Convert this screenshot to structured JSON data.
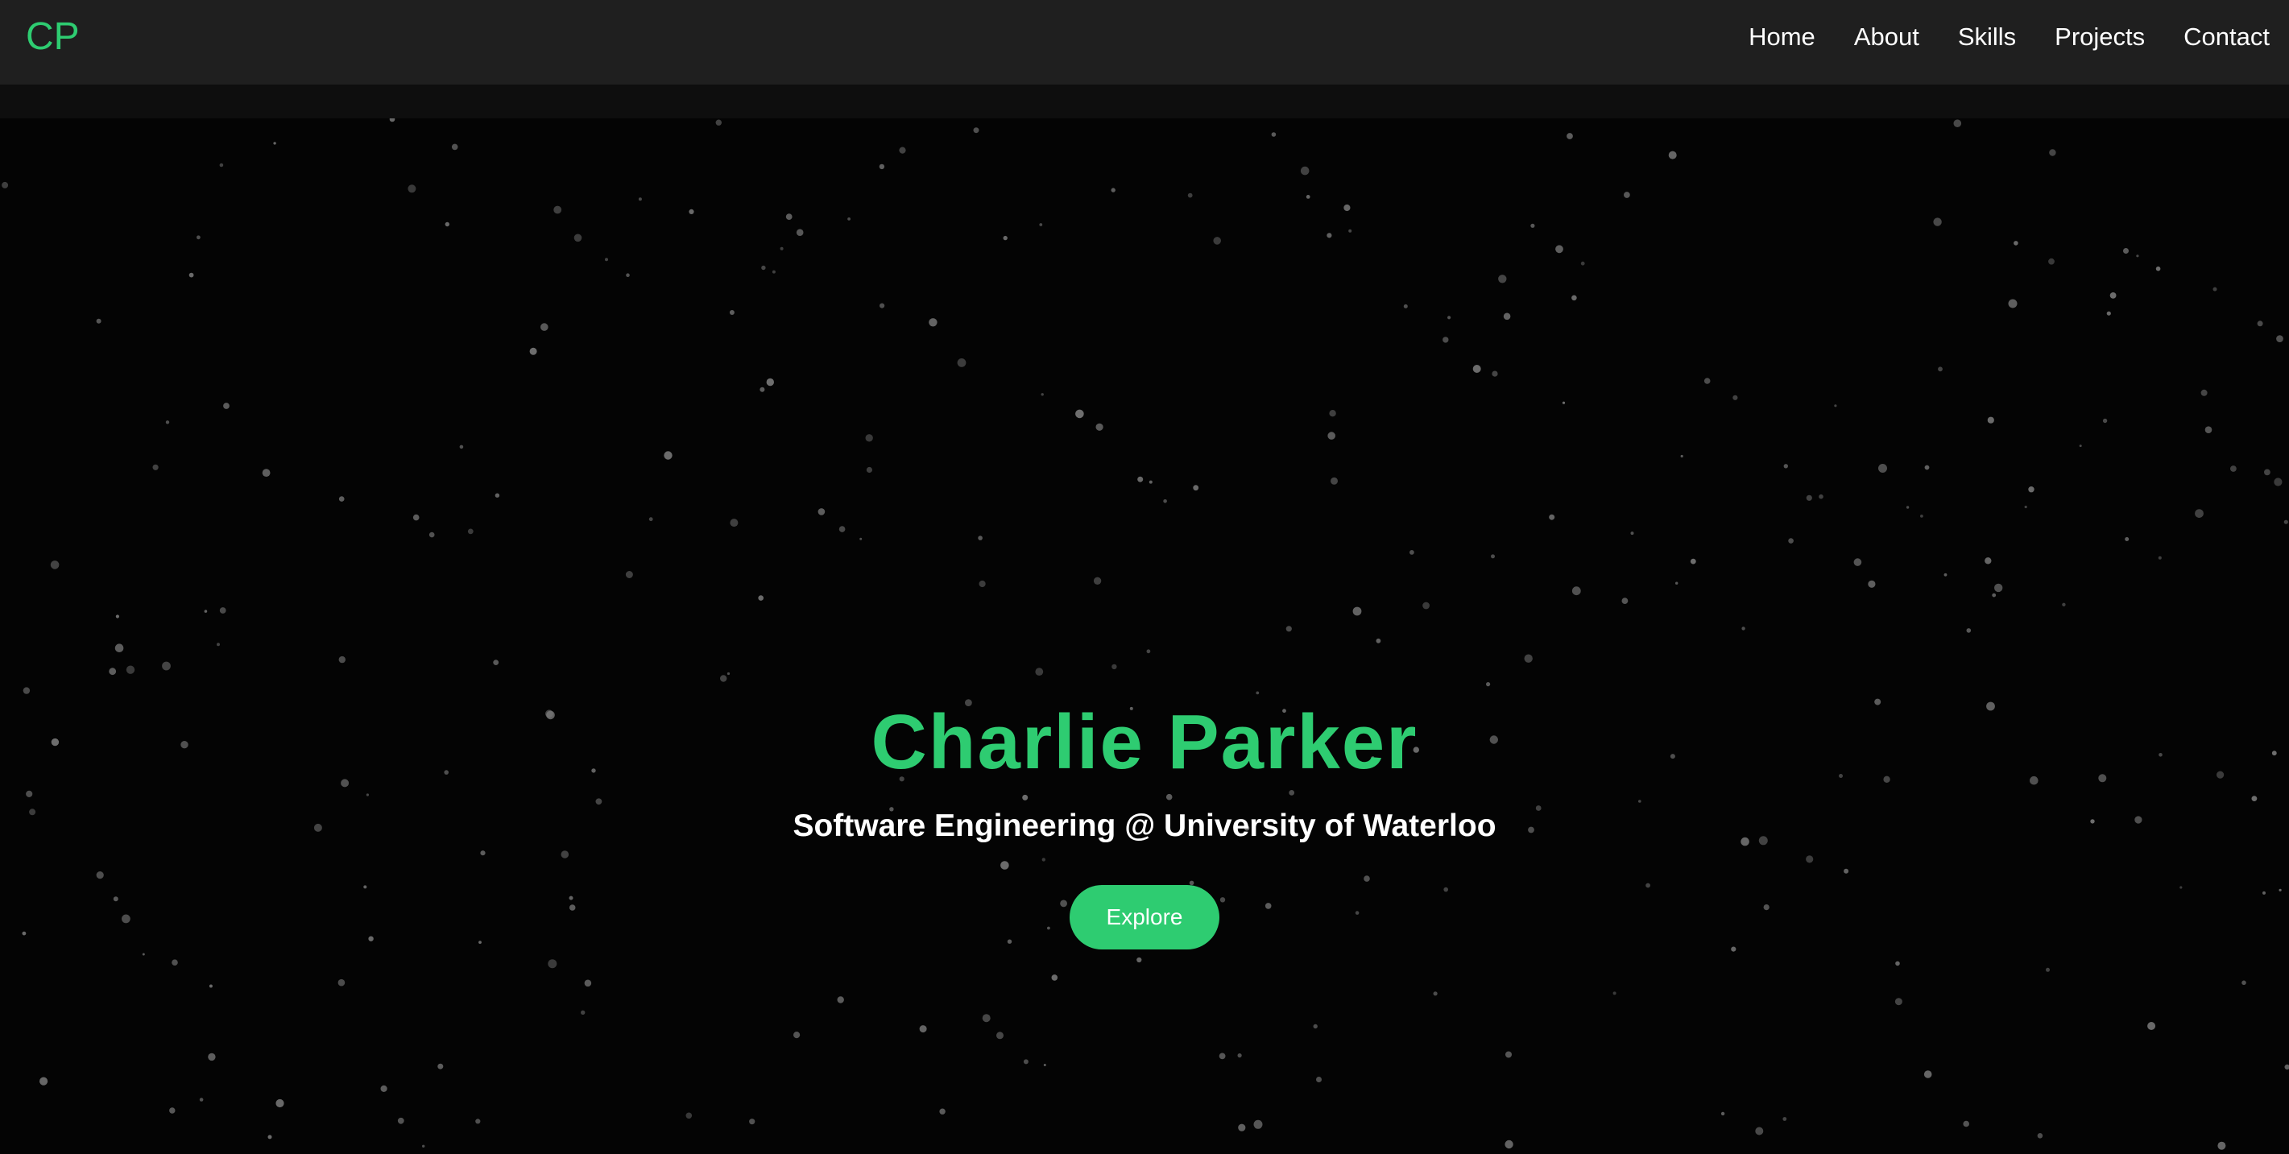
{
  "header": {
    "logo": "CP",
    "nav": [
      {
        "label": "Home"
      },
      {
        "label": "About"
      },
      {
        "label": "Skills"
      },
      {
        "label": "Projects"
      },
      {
        "label": "Contact"
      }
    ]
  },
  "hero": {
    "name": "Charlie Parker",
    "subtitle": "Software Engineering @ University of Waterloo",
    "button_label": "Explore"
  },
  "colors": {
    "accent": "#2ecc71",
    "nav_bg": "#1f1f1f",
    "hero_bg": "#040404",
    "star": "#7a7a7a"
  }
}
